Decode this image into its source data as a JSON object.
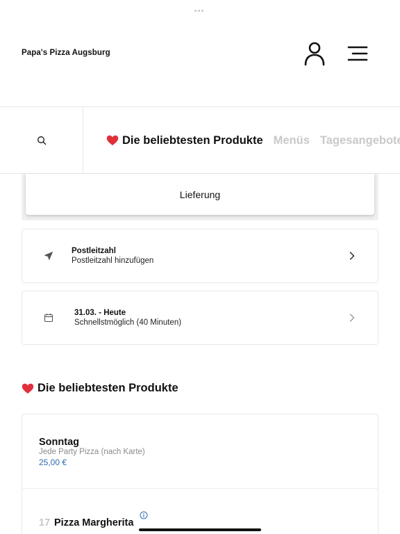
{
  "header": {
    "brand": "Papa's Pizza Augsburg",
    "icons": [
      "user-icon",
      "menu-icon"
    ]
  },
  "tabs": {
    "search_icon": "search-icon",
    "items": [
      {
        "label": "Die beliebtesten Produkte",
        "active": true,
        "emoji": "heart"
      },
      {
        "label": "Menüs",
        "active": false
      },
      {
        "label": "Tagesangebote",
        "active": false
      }
    ]
  },
  "order_mode": {
    "label": "Lieferung"
  },
  "postal": {
    "title": "Postleitzahl",
    "subtitle": "Postleitzahl hinzufügen",
    "icon": "location-arrow-icon"
  },
  "time": {
    "title": "31.03. - Heute",
    "subtitle": "Schnellstmöglich (40 Minuten)",
    "icon": "calendar-icon"
  },
  "section": {
    "title": "Die beliebtesten Produkte"
  },
  "products": [
    {
      "name": "Sonntag",
      "description": "Jede Party Pizza (nach Karte)",
      "price": "25,00 €"
    },
    {
      "number": "17",
      "name": "Pizza Margherita",
      "icon": "info-icon"
    }
  ],
  "colors": {
    "accent_price": "#2b6cb0",
    "heart": "#e0303b",
    "inactive_tab": "#c9c9c9"
  }
}
